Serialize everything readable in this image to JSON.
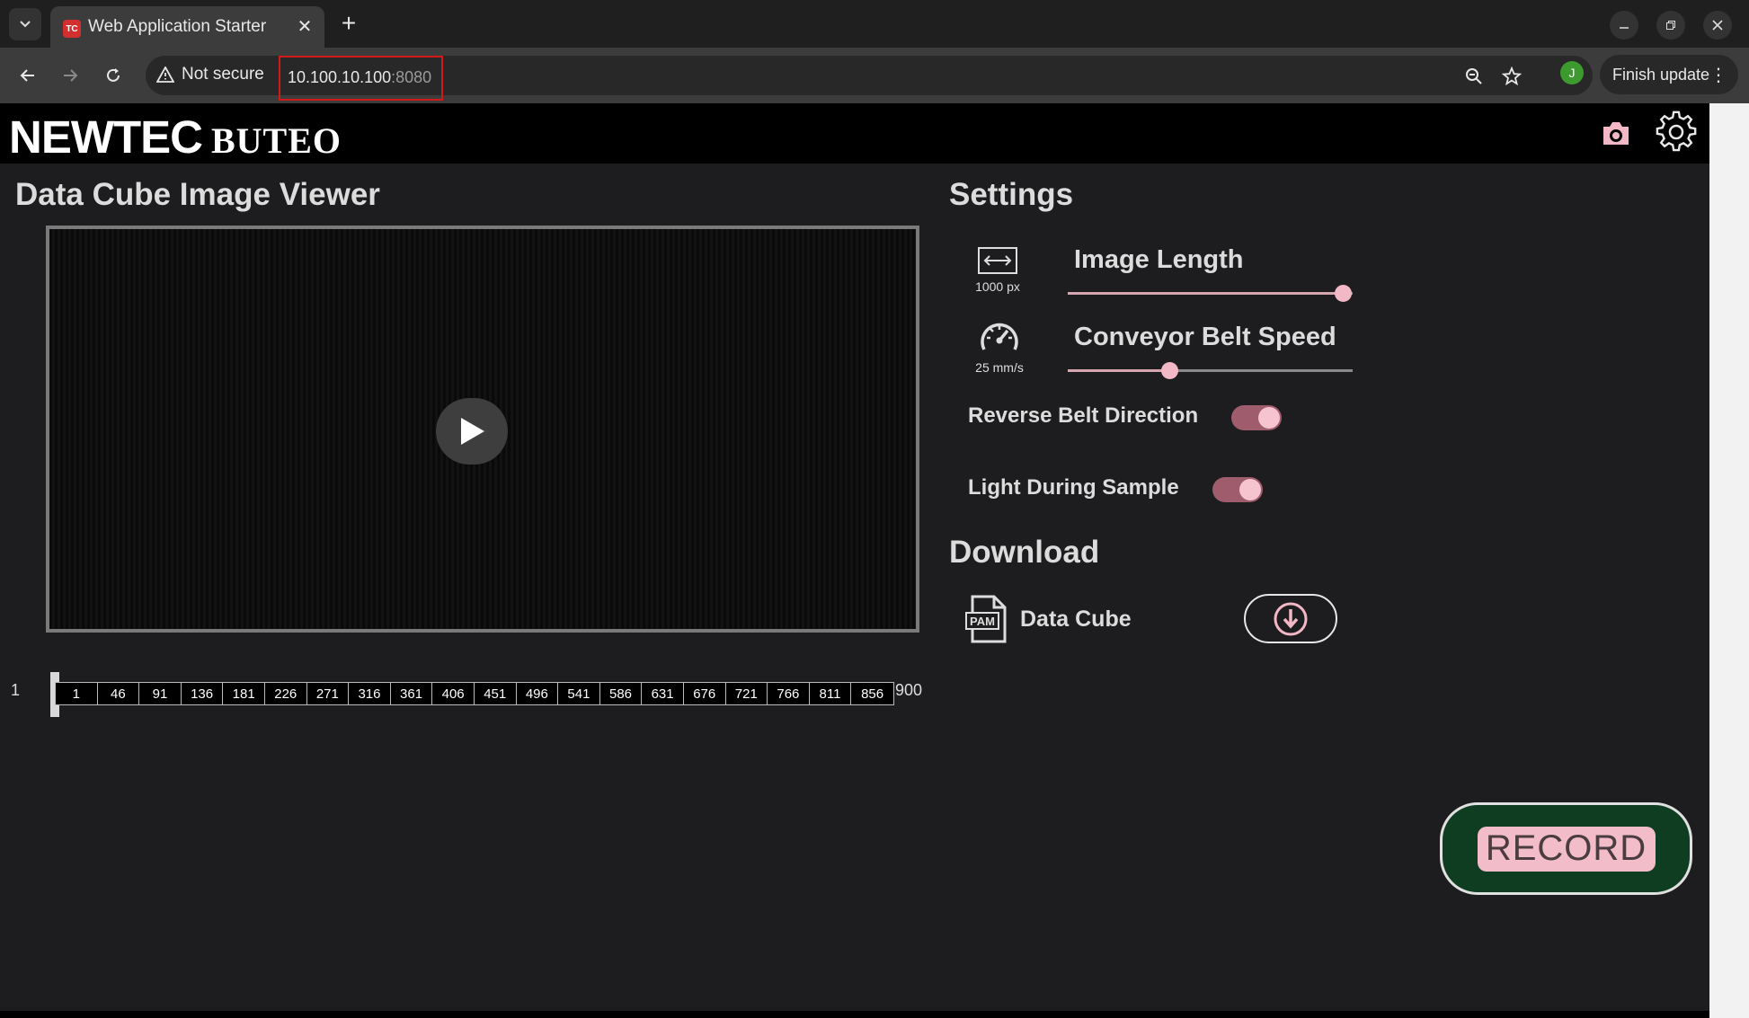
{
  "browser": {
    "tab_title": "Web Application Starter",
    "favicon_text": "TC",
    "security_label": "Not secure",
    "url_host": "10.100.10.100",
    "url_port": ":8080",
    "profile_initial": "J",
    "update_label": "Finish update"
  },
  "app": {
    "logo_main": "NEWTEC",
    "logo_sub": "BUTEO",
    "accent_color": "#f2b8c6",
    "record_bg_color": "#0f3d22"
  },
  "viewer": {
    "title": "Data Cube Image Viewer",
    "timeline_start": "1",
    "timeline_end": "900",
    "timeline_ticks": [
      "1",
      "46",
      "91",
      "136",
      "181",
      "226",
      "271",
      "316",
      "361",
      "406",
      "451",
      "496",
      "541",
      "586",
      "631",
      "676",
      "721",
      "766",
      "811",
      "856"
    ],
    "timeline_position": 1
  },
  "settings": {
    "title": "Settings",
    "image_length": {
      "label": "Image Length",
      "value": "1000 px",
      "slider_fraction": 0.97
    },
    "belt_speed": {
      "label": "Conveyor Belt Speed",
      "value": "25 mm/s",
      "slider_fraction": 0.36
    },
    "reverse_belt": {
      "label": "Reverse Belt Direction",
      "on": true
    },
    "light_sample": {
      "label": "Light During Sample",
      "on": true
    }
  },
  "download": {
    "title": "Download",
    "icon_text": "PAM",
    "item_label": "Data Cube"
  },
  "record": {
    "label": "RECORD"
  }
}
